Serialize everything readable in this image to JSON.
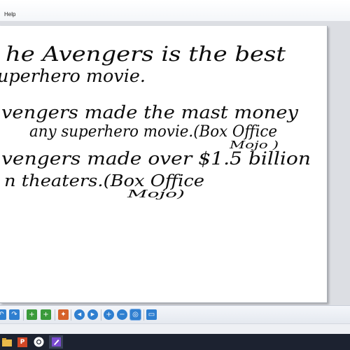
{
  "menu": {
    "help_label": "Help"
  },
  "notes": {
    "lines": [
      "he Avengers  is  the best",
      "uperhero movie.",
      "vengers made the mast money",
      "any superhero movie.(Box Office",
      "Mojo )",
      "vengers made over $1.5 billion",
      "n theaters.(Box Office",
      "Mojo)"
    ]
  },
  "toolbar": {
    "icons": [
      {
        "name": "undo-icon",
        "glyph": "↶",
        "color": "#2f7fd0"
      },
      {
        "name": "redo-icon",
        "glyph": "↷",
        "color": "#2f7fd0"
      },
      {
        "name": "insert-page-icon",
        "glyph": "+",
        "color": "#3a9a3a"
      },
      {
        "name": "add-page-icon",
        "glyph": "+",
        "color": "#3a9a3a"
      },
      {
        "name": "palette-icon",
        "glyph": "✦",
        "color": "#d6612a"
      },
      {
        "name": "previous-page-icon",
        "glyph": "◀",
        "color": "#2f7fd0"
      },
      {
        "name": "next-page-icon",
        "glyph": "▶",
        "color": "#2f7fd0"
      },
      {
        "name": "zoom-in-icon",
        "glyph": "+",
        "color": "#2f7fd0"
      },
      {
        "name": "zoom-out-icon",
        "glyph": "−",
        "color": "#2f7fd0"
      },
      {
        "name": "zoom-fit-icon",
        "glyph": "◎",
        "color": "#2f7fd0"
      },
      {
        "name": "window-icon",
        "glyph": "▭",
        "color": "#2f7fd0"
      }
    ]
  },
  "taskbar": {
    "apps": [
      {
        "name": "windows-explorer-icon",
        "color": "#e8b94a"
      },
      {
        "name": "powerpoint-icon",
        "color": "#d24726",
        "glyph": "P"
      },
      {
        "name": "chrome-icon",
        "color": "#ffffff"
      },
      {
        "name": "notes-app-icon",
        "color": "#7a4bd0"
      }
    ]
  }
}
